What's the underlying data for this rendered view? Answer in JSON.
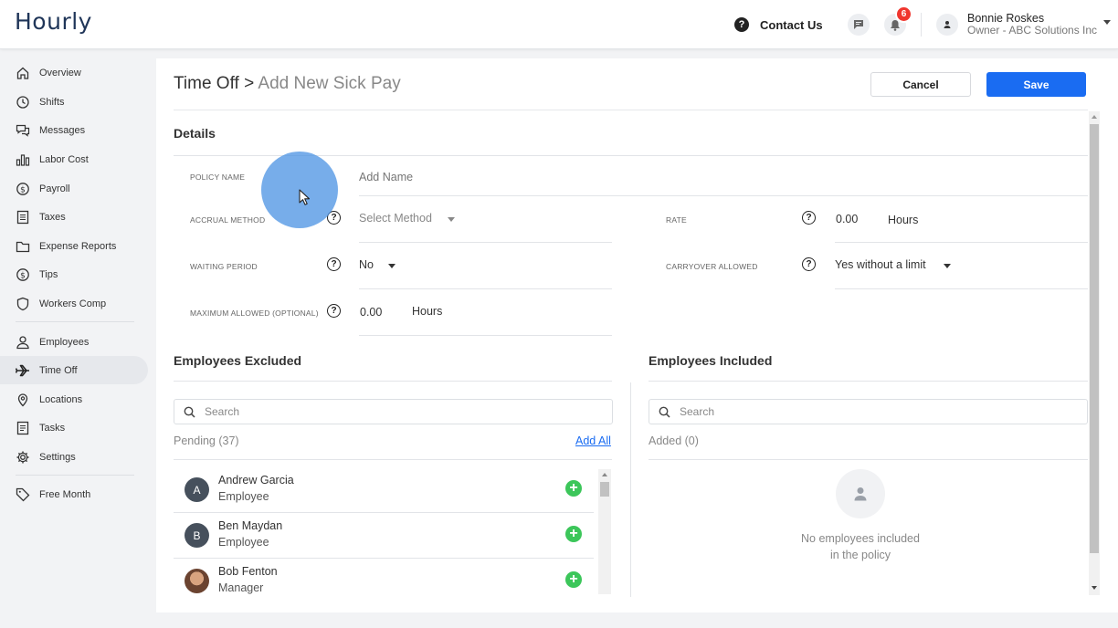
{
  "header": {
    "logo": "Hourly",
    "contact_label": "Contact Us",
    "notification_count": "6",
    "user_name": "Bonnie Roskes",
    "user_role": "Owner - ABC Solutions Inc"
  },
  "sidebar": {
    "items": [
      {
        "label": "Overview",
        "icon": "home-icon"
      },
      {
        "label": "Shifts",
        "icon": "clock-icon"
      },
      {
        "label": "Messages",
        "icon": "chat-icon"
      },
      {
        "label": "Labor Cost",
        "icon": "bar-chart-icon"
      },
      {
        "label": "Payroll",
        "icon": "dollar-icon"
      },
      {
        "label": "Taxes",
        "icon": "document-icon"
      },
      {
        "label": "Expense Reports",
        "icon": "folder-icon"
      },
      {
        "label": "Tips",
        "icon": "dollar-icon"
      },
      {
        "label": "Workers Comp",
        "icon": "shield-icon"
      },
      {
        "label": "Employees",
        "icon": "person-icon"
      },
      {
        "label": "Time Off",
        "icon": "airplane-icon"
      },
      {
        "label": "Locations",
        "icon": "location-pin-icon"
      },
      {
        "label": "Tasks",
        "icon": "list-icon"
      },
      {
        "label": "Settings",
        "icon": "gear-icon"
      },
      {
        "label": "Free Month",
        "icon": "tag-icon"
      }
    ],
    "active": "Time Off"
  },
  "page": {
    "breadcrumb_parent": "Time Off",
    "breadcrumb_sep": " > ",
    "breadcrumb_current": "Add New Sick Pay",
    "cancel_label": "Cancel",
    "save_label": "Save"
  },
  "details": {
    "title": "Details",
    "policy_name_label": "POLICY NAME",
    "policy_name_placeholder": "Add Name",
    "accrual_method_label": "ACCRUAL METHOD",
    "accrual_method_value": "Select Method",
    "rate_label": "RATE",
    "rate_value": "0.00",
    "rate_unit": "Hours",
    "waiting_period_label": "WAITING PERIOD",
    "waiting_period_value": "No",
    "carryover_label": "CARRYOVER ALLOWED",
    "carryover_value": "Yes without a limit",
    "max_allowed_label": "MAXIMUM ALLOWED (OPTIONAL)",
    "max_allowed_value": "0.00",
    "max_allowed_unit": "Hours"
  },
  "excluded": {
    "title": "Employees Excluded",
    "search_placeholder": "Search",
    "count_label": "Pending (37)",
    "add_all_label": "Add All",
    "employees": [
      {
        "initial": "A",
        "name": "Andrew Garcia",
        "role": "Employee"
      },
      {
        "initial": "B",
        "name": "Ben Maydan",
        "role": "Employee"
      },
      {
        "initial": "",
        "name": "Bob Fenton",
        "role": "Manager"
      }
    ]
  },
  "included": {
    "title": "Employees Included",
    "search_placeholder": "Search",
    "count_label": "Added (0)",
    "empty_line1": "No employees included",
    "empty_line2": "in the policy"
  },
  "colors": {
    "accent": "#1a6cf2",
    "add_green": "#3cc65a",
    "badge_red": "#f0362e"
  }
}
